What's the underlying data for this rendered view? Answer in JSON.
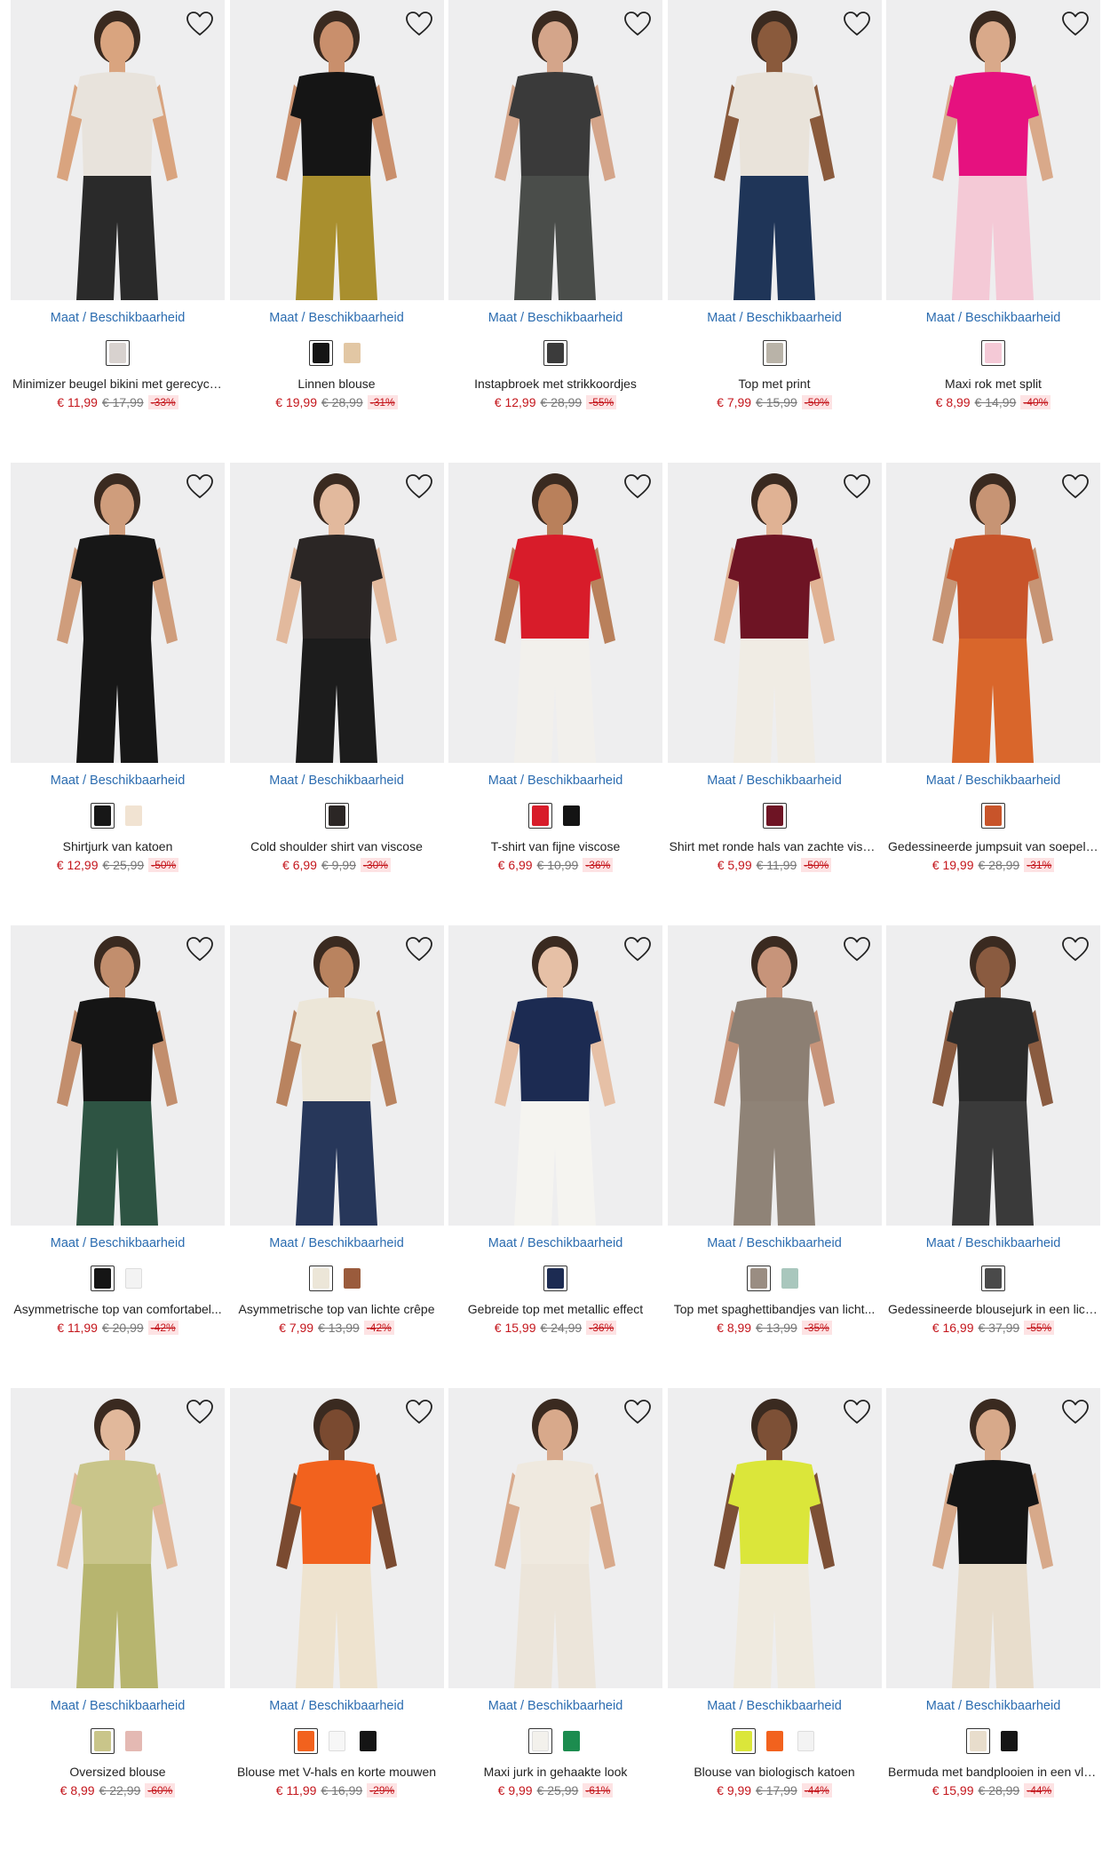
{
  "ui": {
    "maat_label": "Maat / Beschikbaarheid"
  },
  "colors": {
    "price": "#c4161c",
    "link": "#2b6cb0",
    "discount_bg": "#fde3e4",
    "photo_bg": "#eeeeef"
  },
  "products": [
    {
      "name": "Minimizer beugel bikini met gerecycled...",
      "price": "€ 11,99",
      "old_price": "€ 17,99",
      "discount": "-33%",
      "look": {
        "top": "#e8e3dc",
        "bottom": "#2a2a2a",
        "skin": "#d9a47f"
      },
      "swatches": [
        "#d8d2cf"
      ]
    },
    {
      "name": "Linnen blouse",
      "price": "€ 19,99",
      "old_price": "€ 28,99",
      "discount": "-31%",
      "look": {
        "top": "#151515",
        "bottom": "#a98f2e",
        "skin": "#c98f6c"
      },
      "swatches": [
        "#151515",
        "#e2c7a4"
      ]
    },
    {
      "name": "Instapbroek met strikkoordjes",
      "price": "€ 12,99",
      "old_price": "€ 28,99",
      "discount": "-55%",
      "look": {
        "top": "#3a3a3a",
        "bottom": "#4a4d4a",
        "skin": "#d4a58a"
      },
      "swatches": [
        "#3b3b3b"
      ]
    },
    {
      "name": "Top met print",
      "price": "€ 7,99",
      "old_price": "€ 15,99",
      "discount": "-50%",
      "look": {
        "top": "#e9e3da",
        "bottom": "#1f3558",
        "skin": "#8a5a3c"
      },
      "swatches": [
        "#b9b3a8"
      ]
    },
    {
      "name": "Maxi rok met split",
      "price": "€ 8,99",
      "old_price": "€ 14,99",
      "discount": "-40%",
      "look": {
        "top": "#e6117f",
        "bottom": "#f4c9d6",
        "skin": "#d9a98a"
      },
      "swatches": [
        "#f4c9d6"
      ]
    },
    {
      "name": "Shirtjurk van katoen",
      "price": "€ 12,99",
      "old_price": "€ 25,99",
      "discount": "-50%",
      "look": {
        "top": "#171717",
        "bottom": "#171717",
        "skin": "#cf9d7c"
      },
      "swatches": [
        "#171717",
        "#f1e3d2"
      ]
    },
    {
      "name": "Cold shoulder shirt van viscose",
      "price": "€ 6,99",
      "old_price": "€ 9,99",
      "discount": "-30%",
      "look": {
        "top": "#2b2625",
        "bottom": "#1c1c1c",
        "skin": "#e2b99d"
      },
      "swatches": [
        "#2b2625"
      ]
    },
    {
      "name": "T-shirt van fijne viscose",
      "price": "€ 6,99",
      "old_price": "€ 10,99",
      "discount": "-36%",
      "look": {
        "top": "#d81c2a",
        "bottom": "#f2f0ec",
        "skin": "#b9805b"
      },
      "swatches": [
        "#d81c2a",
        "#141414"
      ]
    },
    {
      "name": "Shirt met ronde hals van zachte viscose",
      "price": "€ 5,99",
      "old_price": "€ 11,99",
      "discount": "-50%",
      "look": {
        "top": "#6e1424",
        "bottom": "#f0ece4",
        "skin": "#e0b294"
      },
      "swatches": [
        "#6e1424"
      ]
    },
    {
      "name": "Gedessineerde jumpsuit van soepele viscose",
      "price": "€ 19,99",
      "old_price": "€ 28,99",
      "discount": "-31%",
      "look": {
        "top": "#c8542a",
        "bottom": "#d9662b",
        "skin": "#c79474"
      },
      "swatches": [
        "#c8542a"
      ]
    },
    {
      "name": "Asymmetrische top van comfortabel...",
      "price": "€ 11,99",
      "old_price": "€ 20,99",
      "discount": "-42%",
      "look": {
        "top": "#151515",
        "bottom": "#2e5443",
        "skin": "#c28e6d"
      },
      "swatches": [
        "#151515",
        "#f3f3f3"
      ]
    },
    {
      "name": "Asymmetrische top van lichte crêpe",
      "price": "€ 7,99",
      "old_price": "€ 13,99",
      "discount": "-42%",
      "look": {
        "top": "#ece6d8",
        "bottom": "#27375a",
        "skin": "#b9835f"
      },
      "swatches": [
        "#ece6d8",
        "#9a5b3c"
      ]
    },
    {
      "name": "Gebreide top met metallic effect",
      "price": "€ 15,99",
      "old_price": "€ 24,99",
      "discount": "-36%",
      "look": {
        "top": "#1c2b52",
        "bottom": "#f5f4f0",
        "skin": "#e6c0a6"
      },
      "swatches": [
        "#1c2b52"
      ]
    },
    {
      "name": "Top met spaghettibandjes van licht...",
      "price": "€ 8,99",
      "old_price": "€ 13,99",
      "discount": "-35%",
      "look": {
        "top": "#8c7f73",
        "bottom": "#8f8377",
        "skin": "#c7947a"
      },
      "swatches": [
        "#9a8d82",
        "#a9c7bd"
      ]
    },
    {
      "name": "Gedessineerde blousejurk in een lichte...",
      "price": "€ 16,99",
      "old_price": "€ 37,99",
      "discount": "-55%",
      "look": {
        "top": "#2a2a2a",
        "bottom": "#3a3a3a",
        "skin": "#8a5b40"
      },
      "swatches": [
        "#4a4a4a"
      ]
    },
    {
      "name": "Oversized blouse",
      "price": "€ 8,99",
      "old_price": "€ 22,99",
      "discount": "-60%",
      "look": {
        "top": "#c9c58a",
        "bottom": "#b7b56f",
        "skin": "#e1b89b"
      },
      "swatches": [
        "#c9c58a",
        "#e4b9b3"
      ]
    },
    {
      "name": "Blouse met V-hals en korte mouwen",
      "price": "€ 11,99",
      "old_price": "€ 16,99",
      "discount": "-29%",
      "look": {
        "top": "#f2621e",
        "bottom": "#eee3cf",
        "skin": "#7a4a30"
      },
      "swatches": [
        "#f2621e",
        "#f7f7f7",
        "#151515"
      ]
    },
    {
      "name": "Maxi jurk in gehaakte look",
      "price": "€ 9,99",
      "old_price": "€ 25,99",
      "discount": "-61%",
      "look": {
        "top": "#efe9df",
        "bottom": "#ece5da",
        "skin": "#d8a98b"
      },
      "swatches": [
        "#f3f1ec",
        "#1c8c4f"
      ]
    },
    {
      "name": "Blouse van biologisch katoen",
      "price": "€ 9,99",
      "old_price": "€ 17,99",
      "discount": "-44%",
      "look": {
        "top": "#dbe63a",
        "bottom": "#efeadf",
        "skin": "#7d5036"
      },
      "swatches": [
        "#dbe63a",
        "#f2621e",
        "#f3f3f3"
      ]
    },
    {
      "name": "Bermuda met bandplooien in een vloeiende...",
      "price": "€ 15,99",
      "old_price": "€ 28,99",
      "discount": "-44%",
      "look": {
        "top": "#151515",
        "bottom": "#e8ddcc",
        "skin": "#d7a98a"
      },
      "swatches": [
        "#e8ddcc",
        "#151515"
      ]
    }
  ]
}
